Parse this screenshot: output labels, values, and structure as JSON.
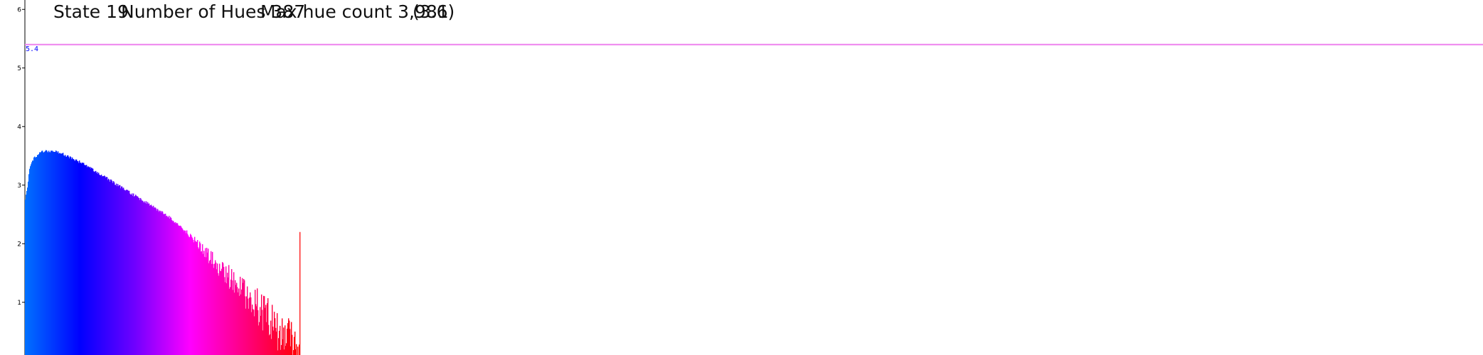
{
  "title_parts": {
    "state": "State 19",
    "hues": "Number of Hues 387",
    "max_count": "Max hue count 3,981",
    "log_max": "(3.6)"
  },
  "chart_data": {
    "type": "bar",
    "title": "State 19   Number of Hues 387  Max hue count 3,981    (3.6)",
    "xlabel": "",
    "ylabel": "",
    "ylim": [
      0.1,
      6.1
    ],
    "yticks": [
      1,
      2,
      3,
      4,
      5,
      6
    ],
    "ytick_labels": [
      "1",
      "2",
      "3",
      "4",
      "5",
      "6"
    ],
    "grid": false,
    "legend": "none",
    "reference_line": {
      "value": 5.4,
      "label": "5.4",
      "color": "#ee82ee",
      "label_color": "#0000ff"
    },
    "bar_count": 387,
    "description_values": {
      "peak": 3.6,
      "start": 2.8,
      "end_min": 0.1,
      "spike_value": 2.2
    },
    "color_stops": [
      "#0070ff",
      "#0000ff",
      "#7000ff",
      "#ff00ff",
      "#ff0080",
      "#ff0000"
    ],
    "values_profile": [
      [
        0,
        2.8
      ],
      [
        3,
        3.0
      ],
      [
        6,
        3.3
      ],
      [
        12,
        3.5
      ],
      [
        25,
        3.6
      ],
      [
        45,
        3.6
      ],
      [
        80,
        3.4
      ],
      [
        120,
        3.1
      ],
      [
        160,
        2.8
      ],
      [
        200,
        2.5
      ],
      [
        240,
        2.1
      ],
      [
        280,
        1.7
      ],
      [
        320,
        1.3
      ],
      [
        350,
        1.0
      ],
      [
        375,
        0.7
      ],
      [
        386,
        0.5
      ]
    ],
    "spike": {
      "index": 386,
      "value": 2.2
    }
  }
}
